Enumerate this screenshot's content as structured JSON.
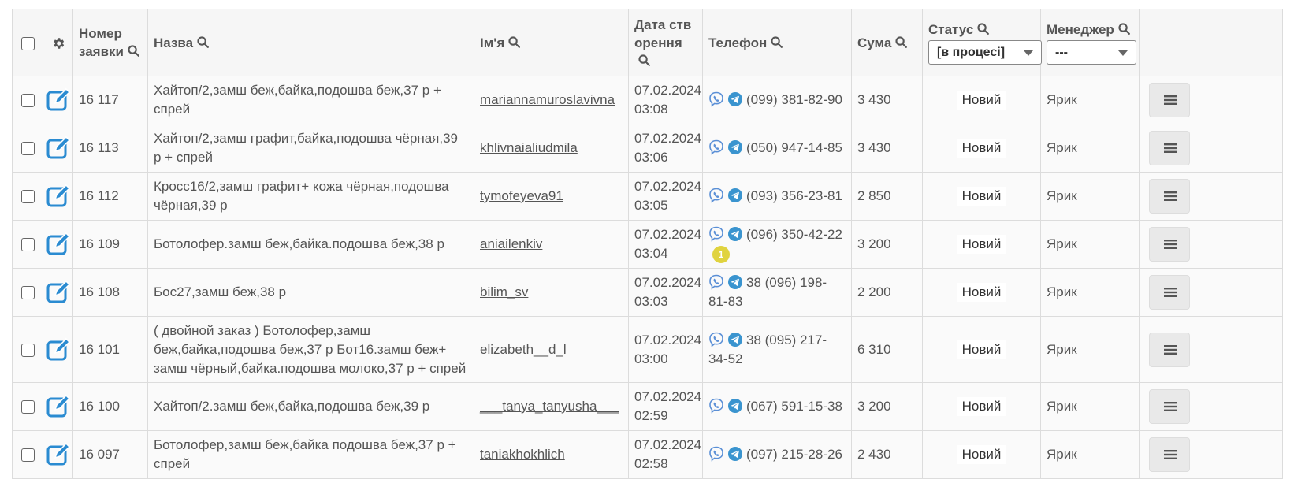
{
  "colors": {
    "accent": "#2a8bd1",
    "viber": "#5a8fd6",
    "telegram": "#3a94cf",
    "badge": "#e0d33f"
  },
  "header": {
    "order_number": "Номер заявки",
    "name": "Назва",
    "customer": "Ім'я",
    "created": "Дата створення",
    "phone": "Телефон",
    "amount": "Сума",
    "status": "Статус",
    "status_select": "[в процесі]",
    "manager": "Менеджер",
    "manager_select": "---"
  },
  "rows": [
    {
      "number": "16 117",
      "title": "Хайтоп/2,замш беж,байка,подошва беж,37 р + спрей",
      "customer": "mariannamuroslavivna",
      "date": "07.02.2024",
      "time": "03:08",
      "phone": "(099) 381-82-90",
      "amount": "3 430",
      "status": "Новий",
      "manager": "Ярик"
    },
    {
      "number": "16 113",
      "title": "Хайтоп/2,замш графит,байка,подошва чёрная,39 р + спрей",
      "customer": "khlivnaialiudmila",
      "date": "07.02.2024",
      "time": "03:06",
      "phone": "(050) 947-14-85",
      "amount": "3 430",
      "status": "Новий",
      "manager": "Ярик"
    },
    {
      "number": "16 112",
      "title": "Кросс16/2,замш графит+ кожа чёрная,подошва чёрная,39 р",
      "customer": "tymofeyeva91",
      "date": "07.02.2024",
      "time": "03:05",
      "phone": "(093) 356-23-81",
      "amount": "2 850",
      "status": "Новий",
      "manager": "Ярик"
    },
    {
      "number": "16 109",
      "title": "Ботолофер.замш беж,байка.подошва беж,38 р",
      "customer": "aniailenkiv",
      "date": "07.02.2024",
      "time": "03:04",
      "phone": "(096) 350-42-22",
      "badge": "1",
      "amount": "3 200",
      "status": "Новий",
      "manager": "Ярик"
    },
    {
      "number": "16 108",
      "title": "Бос27,замш беж,38 р",
      "customer": "bilim_sv",
      "date": "07.02.2024",
      "time": "03:03",
      "phone": "38 (096) 198-81-83",
      "amount": "2 200",
      "status": "Новий",
      "manager": "Ярик"
    },
    {
      "number": "16 101",
      "title": "( двойной заказ ) Ботолофер,замш беж,байка,подошва беж,37 р Бот16.замш беж+ замш чёрный,байка.подошва молоко,37 р + спрей",
      "customer": "elizabeth__d_l",
      "date": "07.02.2024",
      "time": "03:00",
      "phone": "38 (095) 217-34-52",
      "amount": "6 310",
      "status": "Новий",
      "manager": "Ярик"
    },
    {
      "number": "16 100",
      "title": "Хайтоп/2.замш беж,байка,подошва беж,39 р",
      "customer": "___tanya_tanyusha___",
      "date": "07.02.2024",
      "time": "02:59",
      "phone": "(067) 591-15-38",
      "amount": "3 200",
      "status": "Новий",
      "manager": "Ярик"
    },
    {
      "number": "16 097",
      "title": "Ботолофер,замш беж,байка подошва беж,37 р + спрей",
      "customer": "taniakhokhlich",
      "date": "07.02.2024",
      "time": "02:58",
      "phone": "(097) 215-28-26",
      "amount": "2 430",
      "status": "Новий",
      "manager": "Ярик"
    }
  ]
}
